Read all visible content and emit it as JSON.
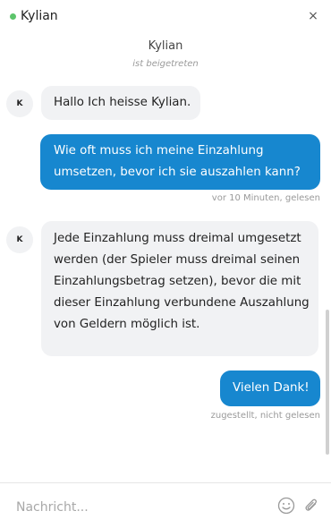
{
  "header": {
    "contact_name": "Kylian",
    "status_color": "#5cc46b",
    "close_glyph": "×"
  },
  "system": {
    "joined_name": "Kylian",
    "joined_text": "ist beigetreten"
  },
  "messages": [
    {
      "from": "agent",
      "avatar": "K",
      "text": "Hallo Ich heisse Kylian."
    },
    {
      "from": "user",
      "text": "Wie oft muss ich meine Einzahlung umsetzen, bevor ich sie auszahlen kann?",
      "meta": "vor 10 Minuten, gelesen"
    },
    {
      "from": "agent",
      "avatar": "K",
      "text": "Jede Einzahlung muss dreimal umgesetzt werden (der Spieler muss dreimal seinen Einzahlungsbetrag setzen), bevor die mit dieser Einzahlung verbundene Auszahlung von Geldern möglich ist."
    },
    {
      "from": "user",
      "text": "Vielen Dank!",
      "meta": "zugestellt, nicht gelesen"
    }
  ],
  "composer": {
    "placeholder": "Nachricht...",
    "emoji_icon": "smiley-icon",
    "attach_icon": "paperclip-icon"
  },
  "colors": {
    "outgoing_bubble": "#1787cf",
    "incoming_bubble": "#f1f2f4"
  }
}
